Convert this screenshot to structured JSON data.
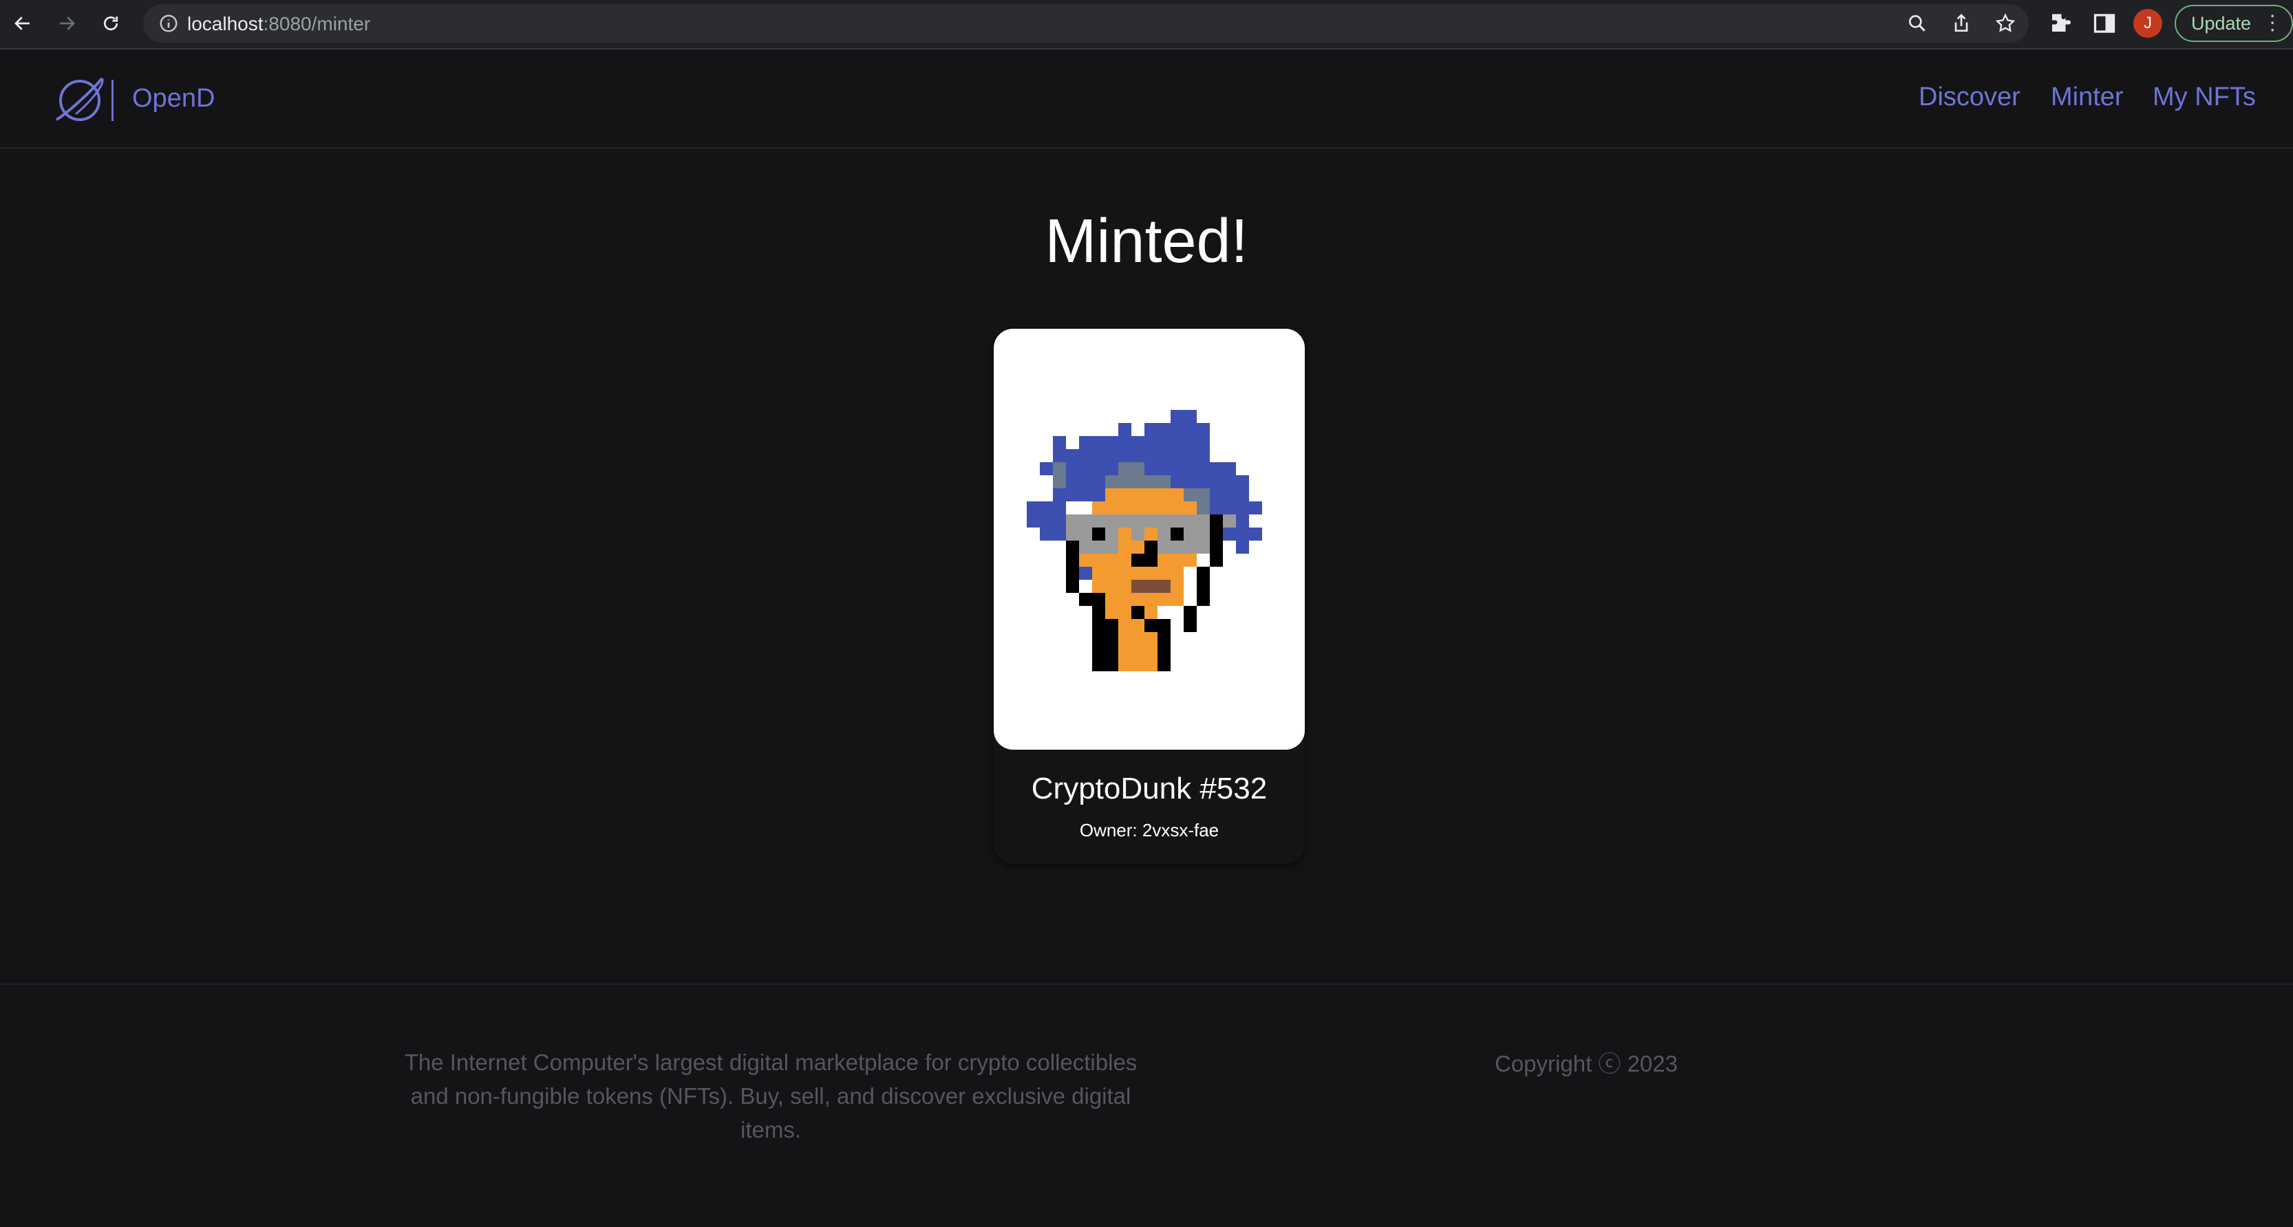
{
  "browser": {
    "url_host": "localhost",
    "url_rest": ":8080/minter",
    "profile_initial": "J",
    "update_label": "Update"
  },
  "app": {
    "brand": "OpenD",
    "nav": [
      {
        "label": "Discover"
      },
      {
        "label": "Minter"
      },
      {
        "label": "My NFTs"
      }
    ],
    "accent_color": "#6f74d6"
  },
  "page": {
    "title": "Minted!"
  },
  "nft": {
    "name": "CryptoDunk #532",
    "owner": "Owner: 2vxsx-fae"
  },
  "footer": {
    "description": "The Internet Computer's largest digital marketplace for crypto collectibles and non-fungible tokens (NFTs). Buy, sell, and discover exclusive digital items.",
    "copyright": "Copyright ⓒ 2023"
  }
}
